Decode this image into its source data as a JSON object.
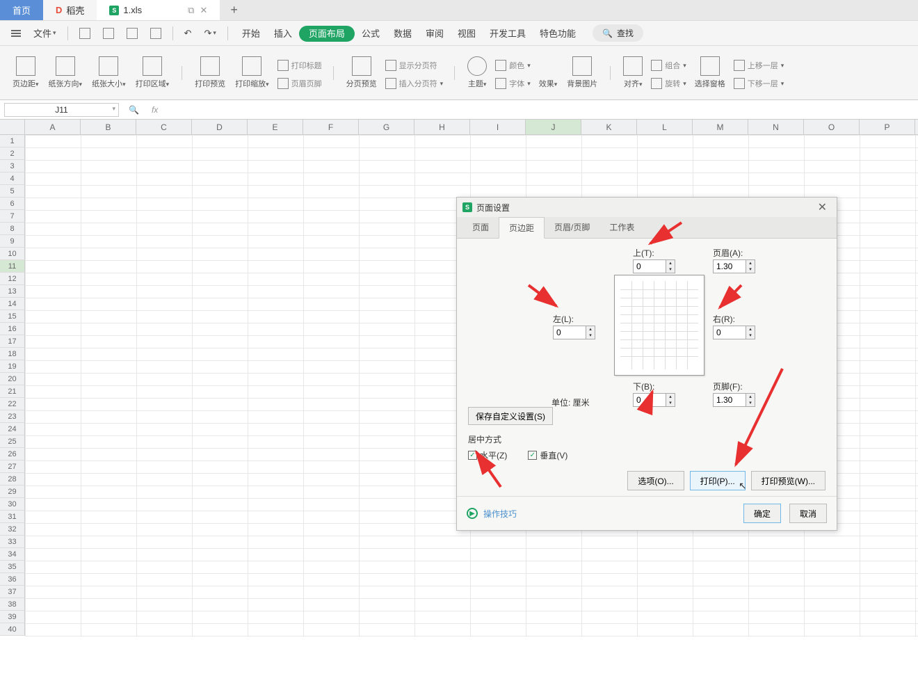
{
  "tabs": {
    "home": "首页",
    "shell": "稻壳",
    "file": "1.xls"
  },
  "toolbar": {
    "file_menu": "文件",
    "menus": [
      "开始",
      "插入",
      "页面布局",
      "公式",
      "数据",
      "审阅",
      "视图",
      "开发工具",
      "特色功能"
    ],
    "search": "查找"
  },
  "ribbon": {
    "margin": "页边距",
    "orient": "纸张方向",
    "size": "纸张大小",
    "print_area": "打印区域",
    "preview": "打印预览",
    "scale": "打印缩放",
    "print_title": "打印标题",
    "header_footer": "页眉页脚",
    "page_preview": "分页预览",
    "show_split": "显示分页符",
    "insert_break": "插入分页符",
    "theme": "主题",
    "color": "颜色",
    "font": "字体",
    "effect": "效果",
    "bg": "背景图片",
    "align": "对齐",
    "rotate": "旋转",
    "group": "组合",
    "select_pane": "选择窗格",
    "move_up": "上移一层",
    "move_down": "下移一层"
  },
  "namebox": "J11",
  "columns": [
    "A",
    "B",
    "C",
    "D",
    "E",
    "F",
    "G",
    "H",
    "I",
    "J",
    "K",
    "L",
    "M",
    "N",
    "O",
    "P"
  ],
  "active_col_index": 9,
  "active_row": 11,
  "dialog": {
    "title": "页面设置",
    "tabs": [
      "页面",
      "页边距",
      "页眉/页脚",
      "工作表"
    ],
    "active_tab": 1,
    "top": {
      "label": "上(T):",
      "value": "0"
    },
    "header": {
      "label": "页眉(A):",
      "value": "1.30"
    },
    "left": {
      "label": "左(L):",
      "value": "0"
    },
    "right": {
      "label": "右(R):",
      "value": "0"
    },
    "bottom": {
      "label": "下(B):",
      "value": "0"
    },
    "footer": {
      "label": "页脚(F):",
      "value": "1.30"
    },
    "unit": "单位: 厘米",
    "save_custom": "保存自定义设置(S)",
    "center_title": "居中方式",
    "horiz": "水平(Z)",
    "vert": "垂直(V)",
    "options": "选项(O)...",
    "print": "打印(P)...",
    "print_preview": "打印预览(W)...",
    "tips": "操作技巧",
    "ok": "确定",
    "cancel": "取消"
  }
}
